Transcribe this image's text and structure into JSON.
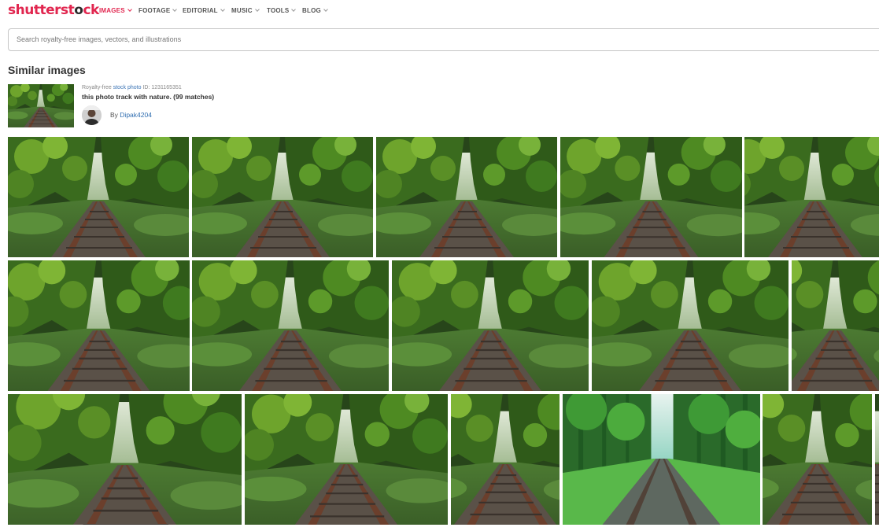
{
  "header": {
    "logo_left": "shutterst",
    "logo_right": "ck",
    "logo_o": "o",
    "nav": [
      {
        "label": "IMAGES",
        "active": true
      },
      {
        "label": "FOOTAGE"
      },
      {
        "label": "EDITORIAL"
      },
      {
        "label": "MUSIC"
      },
      {
        "label": "TOOLS"
      },
      {
        "label": "BLOG"
      }
    ]
  },
  "search": {
    "placeholder": "Search royalty-free images, vectors, and illustrations",
    "value": ""
  },
  "similar": {
    "heading": "Similar images",
    "license": "Royalty-free",
    "type_link": "stock photo",
    "id_text": "ID: 1231165351",
    "description": "this photo track with nature. (99 matches)",
    "by": "By",
    "author": "Dipak4204"
  },
  "colors": {
    "brand": "#e1264f",
    "link": "#2f6db0"
  },
  "grid": {
    "rows": [
      {
        "items": 5,
        "variant": [
          "tunnel",
          "tunnel",
          "tunnel",
          "tunnel",
          "tunnel"
        ]
      },
      {
        "items": 5,
        "variant": [
          "tunnel",
          "tunnel",
          "tunnel",
          "tunnel",
          "tunnel"
        ]
      },
      {
        "items": 6,
        "variant": [
          "tunnel",
          "tunnel",
          "tunnel",
          "forest",
          "tunnel",
          "tunnel"
        ]
      }
    ]
  }
}
